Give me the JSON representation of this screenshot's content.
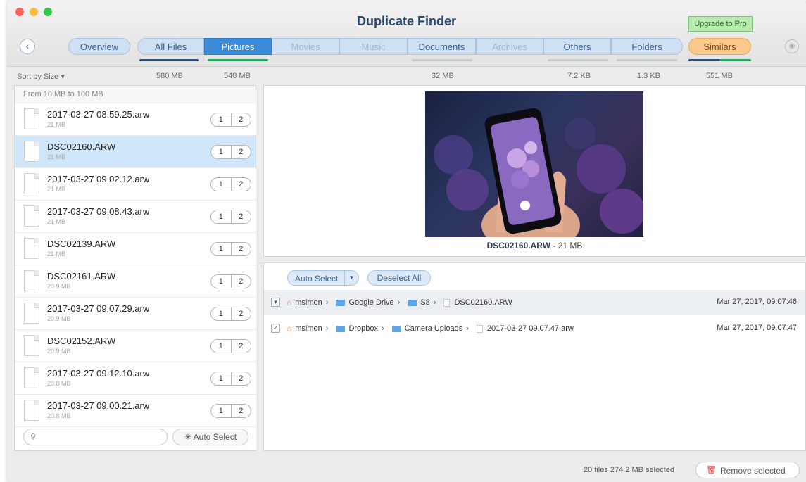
{
  "window": {
    "title": "Duplicate Finder",
    "upgrade_label": "Upgrade to Pro"
  },
  "tabs": {
    "overview": "Overview",
    "all_files": "All Files",
    "pictures": "Pictures",
    "movies": "Movies",
    "music": "Music",
    "documents": "Documents",
    "archives": "Archives",
    "others": "Others",
    "folders": "Folders",
    "similars": "Similars"
  },
  "sizes": {
    "sort_label": "Sort by Size",
    "all_files": "580 MB",
    "pictures": "548 MB",
    "documents": "32 MB",
    "others": "7.2 KB",
    "folders": "1.3 KB",
    "similars": "551 MB"
  },
  "file_list": {
    "group_header": "From 10 MB to 100 MB",
    "items": [
      {
        "name": "2017-03-27 08.59.25.arw",
        "size": "21 MB"
      },
      {
        "name": "DSC02160.ARW",
        "size": "21 MB"
      },
      {
        "name": "2017-03-27 09.02.12.arw",
        "size": "21 MB"
      },
      {
        "name": "2017-03-27 09.08.43.arw",
        "size": "21 MB"
      },
      {
        "name": "DSC02139.ARW",
        "size": "21 MB"
      },
      {
        "name": "DSC02161.ARW",
        "size": "20.9 MB"
      },
      {
        "name": "2017-03-27 09.07.29.arw",
        "size": "20.9 MB"
      },
      {
        "name": "DSC02152.ARW",
        "size": "20.9 MB"
      },
      {
        "name": "2017-03-27 09.12.10.arw",
        "size": "20.8 MB"
      },
      {
        "name": "2017-03-27 09.00.21.arw",
        "size": "20.8 MB"
      }
    ],
    "pill_1": "1",
    "pill_2": "2",
    "search_placeholder": "",
    "auto_select_label": "Auto Select"
  },
  "preview": {
    "file_name": "DSC02160.ARW",
    "file_size": " - 21 MB"
  },
  "details": {
    "auto_select_label": "Auto Select",
    "deselect_label": "Deselect All",
    "rows": [
      {
        "user": "msimon",
        "folder1": "Google Drive",
        "folder2": "S8",
        "file": "DSC02160.ARW",
        "date": "Mar 27, 2017, 09:07:46"
      },
      {
        "user": "msimon",
        "folder1": "Dropbox",
        "folder2": "Camera Uploads",
        "file": "2017-03-27 09.07.47.arw",
        "date": "Mar 27, 2017, 09:07:47"
      }
    ]
  },
  "status": {
    "text": "20 files 274.2 MB selected",
    "remove_label": "Remove selected"
  },
  "colors": {
    "accent": "#3a8cd9",
    "similars": "#fbc98b",
    "upgrade": "#b9eab0",
    "selected_row": "#cfe6fb"
  }
}
